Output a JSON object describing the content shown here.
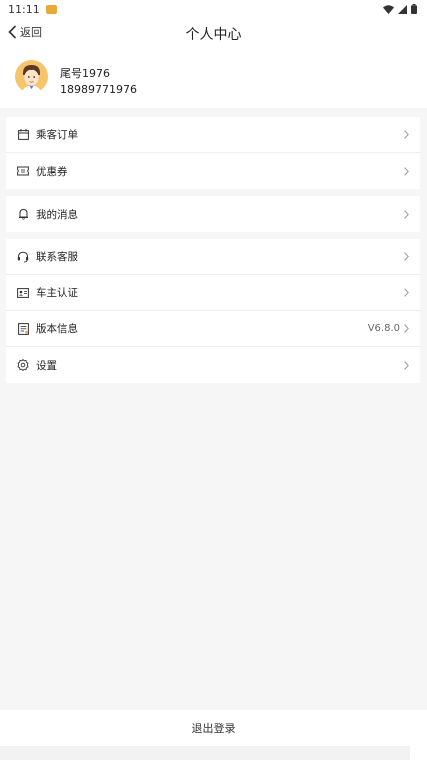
{
  "status_bar": {
    "time": "11:11"
  },
  "nav": {
    "back_label": "返回",
    "title": "个人中心"
  },
  "profile": {
    "name": "尾号1976",
    "phone": "18989771976"
  },
  "menu_groups": [
    {
      "items": [
        {
          "label": "乘客订单",
          "icon": "calendar-icon"
        },
        {
          "label": "优惠券",
          "icon": "ticket-icon"
        }
      ]
    },
    {
      "items": [
        {
          "label": "我的消息",
          "icon": "bell-icon"
        }
      ]
    },
    {
      "items": [
        {
          "label": "联系客服",
          "icon": "headset-icon"
        },
        {
          "label": "车主认证",
          "icon": "id-card-icon"
        },
        {
          "label": "版本信息",
          "icon": "document-icon",
          "value": "V6.8.0"
        },
        {
          "label": "设置",
          "icon": "gear-icon"
        }
      ]
    }
  ],
  "logout_label": "退出登录"
}
